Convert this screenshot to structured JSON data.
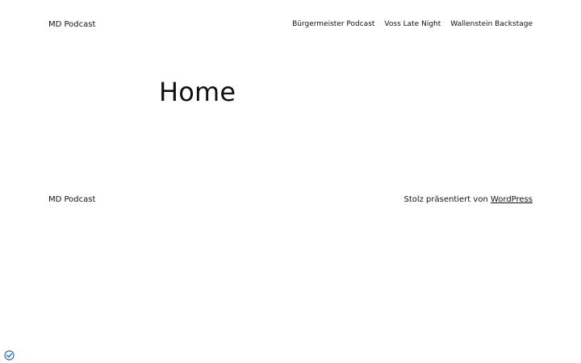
{
  "header": {
    "site_title": "MD Podcast",
    "nav": [
      "Bürgermeister Podcast",
      "Voss Late Night",
      "Wallenstein Backstage"
    ]
  },
  "main": {
    "title": "Home"
  },
  "footer": {
    "site_title": "MD Podcast",
    "credit_text": "Stolz präsentiert von ",
    "credit_link": "WordPress"
  },
  "badge": {
    "icon": "check-shield-icon",
    "color": "#2f6db5"
  }
}
